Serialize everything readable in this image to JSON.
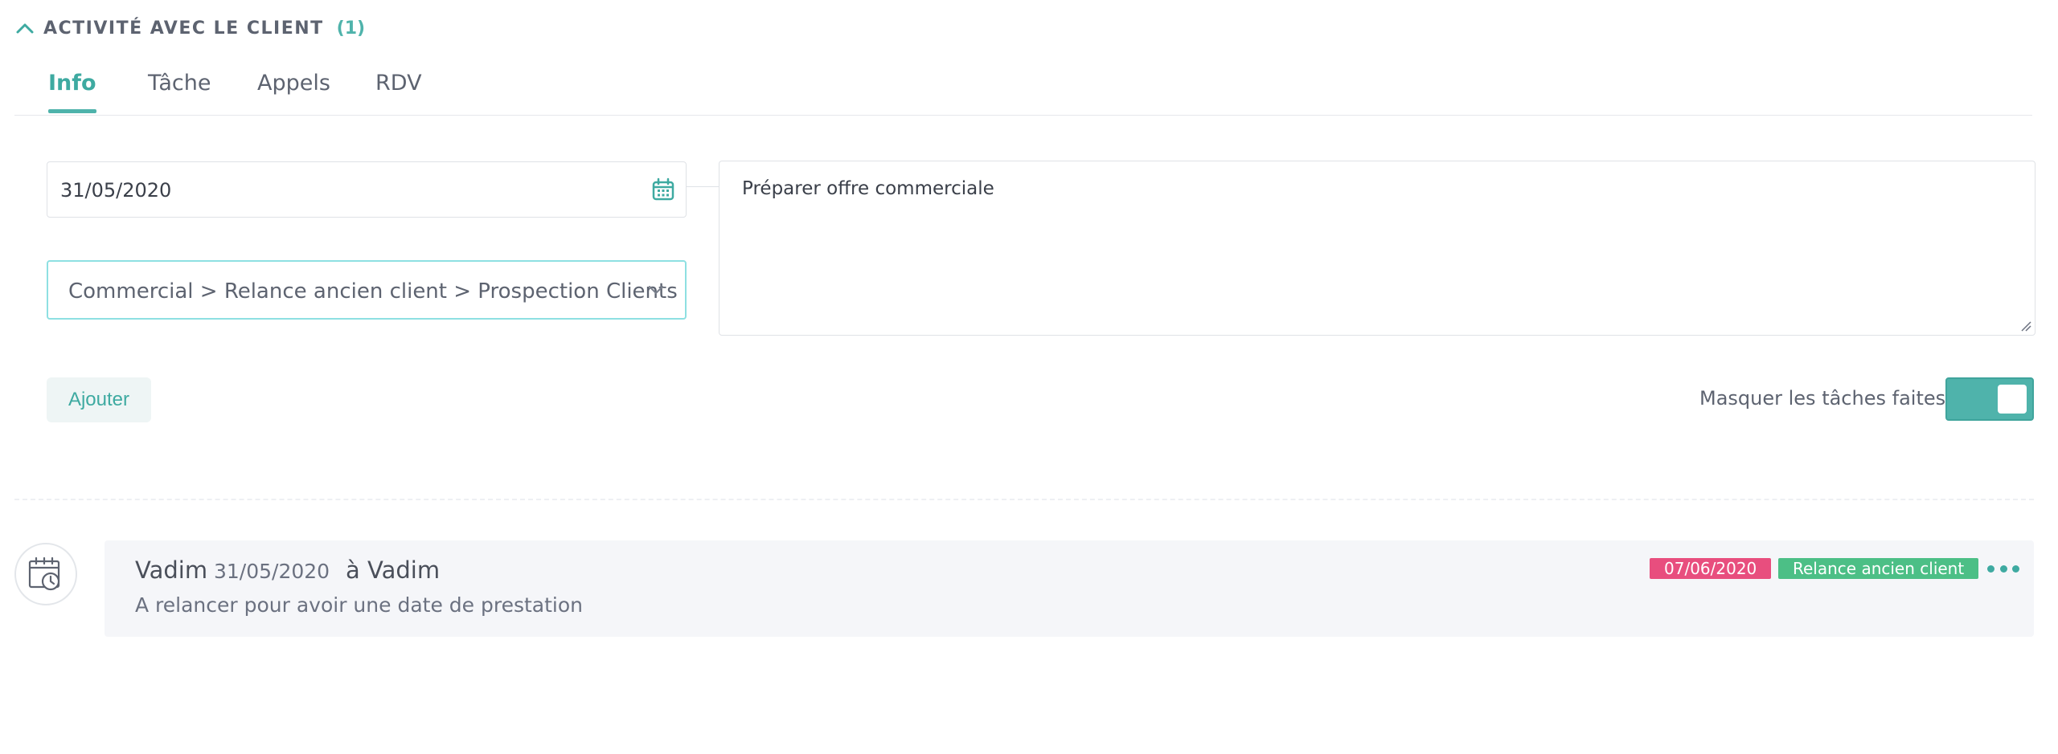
{
  "section": {
    "title": "ACTIVITÉ AVEC LE CLIENT",
    "count": "(1)"
  },
  "tabs": [
    {
      "label": "Info",
      "active": true
    },
    {
      "label": "Tâche",
      "active": false
    },
    {
      "label": "Appels",
      "active": false
    },
    {
      "label": "RDV",
      "active": false
    }
  ],
  "form": {
    "date_value": "31/05/2020",
    "category_value": "Commercial > Relance ancien client > Prospection Clients",
    "note_value": "Préparer offre commerciale",
    "add_label": "Ajouter",
    "hide_done_label": "Masquer les tâches faites",
    "hide_done_on": true
  },
  "timeline": {
    "items": [
      {
        "author": "Vadim",
        "date": "31/05/2020",
        "recipient": "à Vadim",
        "description": "A relancer pour avoir une date de prestation",
        "due_date": "07/06/2020",
        "type": "Relance ancien client",
        "icon": "calendar-clock-icon"
      }
    ]
  },
  "colors": {
    "accent": "#4fb3ab",
    "due_badge": "#e84e7e",
    "type_badge": "#4cbf86",
    "select_border": "#8ee0e2"
  }
}
